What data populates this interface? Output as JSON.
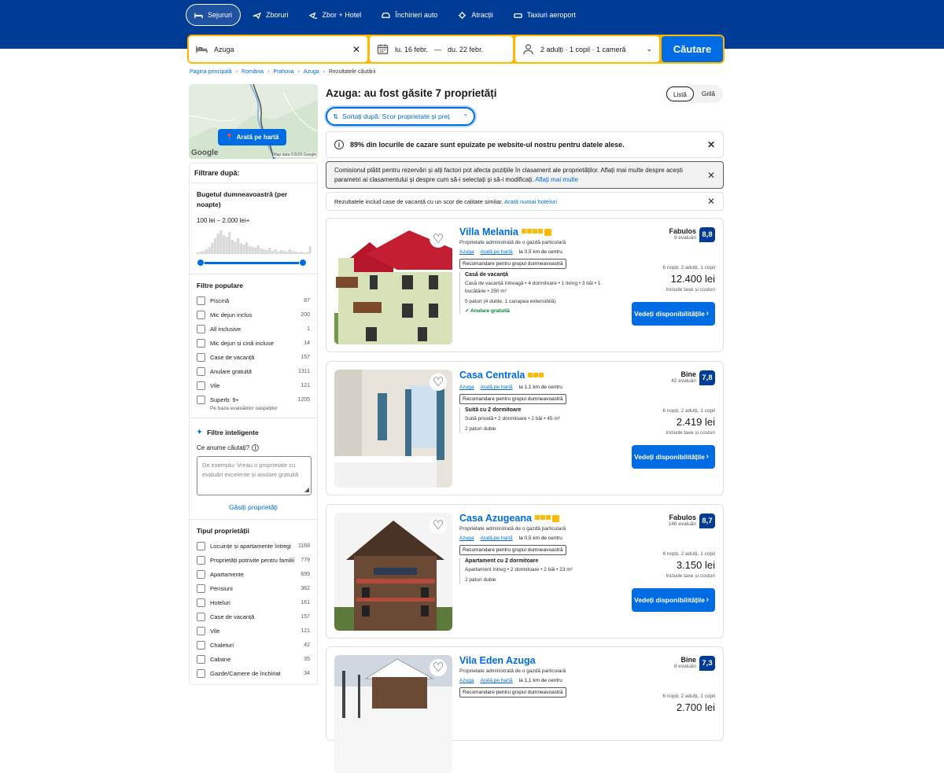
{
  "nav": {
    "tabs": [
      {
        "label": "Sejururi",
        "icon": "bed-icon",
        "active": true
      },
      {
        "label": "Zboruri",
        "icon": "plane-icon"
      },
      {
        "label": "Zbor + Hotel",
        "icon": "plane-bed-icon"
      },
      {
        "label": "Închirieri auto",
        "icon": "car-icon"
      },
      {
        "label": "Atracții",
        "icon": "attractions-icon"
      },
      {
        "label": "Taxiuri aeroport",
        "icon": "taxi-icon"
      }
    ]
  },
  "search": {
    "destination": "Azuga",
    "checkin": "lu. 16 febr.",
    "dash": "—",
    "checkout": "du. 22 febr.",
    "occupancy": "2 adulți · 1 copil · 1 cameră",
    "button": "Căutare",
    "accent": "#ffb700"
  },
  "breadcrumb": [
    "Pagina principală",
    "România",
    "Prahova",
    "Azuga",
    "Rezultatele căutării"
  ],
  "map": {
    "button": "Arată pe hartă",
    "logo": "Google",
    "attribution": "Map data ©2026 Google"
  },
  "filters": {
    "title": "Filtrare după:",
    "budget_title": "Bugetul dumneavoastră (per noapte)",
    "budget_range": "100 lei – 2.000 lei+",
    "popular_title": "Filtre populare",
    "popular": [
      {
        "label": "Piscină",
        "count": "87"
      },
      {
        "label": "Mic dejun inclus",
        "count": "200"
      },
      {
        "label": "All inclusive",
        "count": "1"
      },
      {
        "label": "Mic dejun și cină incluse",
        "count": "14"
      },
      {
        "label": "Case de vacanță",
        "count": "157"
      },
      {
        "label": "Anulare gratuită",
        "count": "1311"
      },
      {
        "label": "Vile",
        "count": "121"
      },
      {
        "label": "Superb: 9+",
        "count": "1205",
        "sub": "Pe baza evaluărilor oaspeților"
      }
    ],
    "smart_title": "Filtre inteligente",
    "smart_question": "Ce anume căutați?",
    "smart_placeholder": "De exemplu: Vreau o proprietate cu evaluări excelente și anulare gratuită",
    "smart_link": "Găsiți proprietăți",
    "type_title": "Tipul proprietății",
    "types": [
      {
        "label": "Locuințe și apartamente întregi",
        "count": "1168"
      },
      {
        "label": "Proprietăți potrivite pentru familii",
        "count": "779"
      },
      {
        "label": "Apartamente",
        "count": "699"
      },
      {
        "label": "Pensiuni",
        "count": "362"
      },
      {
        "label": "Hoteluri",
        "count": "161"
      },
      {
        "label": "Case de vacanță",
        "count": "157"
      },
      {
        "label": "Vile",
        "count": "121"
      },
      {
        "label": "Chaleturi",
        "count": "42"
      },
      {
        "label": "Cabane",
        "count": "35"
      },
      {
        "label": "Gazde/Camere de închiriat",
        "count": "34"
      }
    ]
  },
  "results": {
    "heading": "Azuga: au fost găsite 7 proprietăți",
    "view_list": "Listă",
    "view_grid": "Grilă",
    "sort": "Sortați după: Scor proprietate și preț",
    "alert1": "89% din locurile de cazare sunt epuizate pe website-ul nostru pentru datele alese.",
    "alert2": "Comisionul plătit pentru rezervări și alți factori pot afecta pozițiile în clasament ale proprietăților. Aflați mai multe despre acești parametri ai clasamentului și despre cum să-i selectați și să-i modificați.",
    "alert2_link": "Aflați mai multe",
    "alert3": "Rezultatele includ case de vacanță cu un scor de calitate similar.",
    "alert3_link": "Arată numai hoteluri"
  },
  "properties": [
    {
      "name": "Villa Melania",
      "stars": 4,
      "thumb": true,
      "sub": "Proprietate administrată de o gazdă particulară",
      "loc_town": "Azuga",
      "loc_map": "Arată pe hartă",
      "loc_dist": "la 0,5 km de centru",
      "rec": "Recomandare pentru grupul dumneavoastră",
      "room": "Casă de vacanță",
      "details1": "Casă de vacanță întreagă • 4 dormitoare • 1 living • 3 băi • 1 bucătărie • 250 m²",
      "details2": "5 paturi (4 duble, 1 canapea extensibilă)",
      "cancel": "Anulare gratuită",
      "score_word": "Fabulos",
      "reviews": "9 evaluări",
      "score": "8,8",
      "stay": "6 nopți, 2 adulți, 1 copil",
      "price": "12.400 lei",
      "taxes": "Include taxe și costuri",
      "cta": "Vedeți disponibilitățile"
    },
    {
      "name": "Casa Centrala",
      "stars": 3,
      "thumb": false,
      "loc_town": "Azuga",
      "loc_map": "Arată pe hartă",
      "loc_dist": "la 1,1 km de centru",
      "rec": "Recomandare pentru grupul dumneavoastră",
      "room": "Suită cu 2 dormitoare",
      "details1": "Suită privată • 2 dormitoare • 2 băi • 45 m²",
      "details2": "2 paturi duble",
      "score_word": "Bine",
      "reviews": "42 evaluări",
      "score": "7,8",
      "stay": "6 nopți, 2 adulți, 1 copil",
      "price": "2.419 lei",
      "taxes": "Include taxe și costuri",
      "cta": "Vedeți disponibilitățile"
    },
    {
      "name": "Casa Azugeana",
      "stars": 3,
      "thumb": true,
      "sub": "Proprietate administrată de o gazdă particulară",
      "loc_town": "Azuga",
      "loc_map": "Arată pe hartă",
      "loc_dist": "la 0,5 km de centru",
      "rec": "Recomandare pentru grupul dumneavoastră",
      "room": "Apartament cu 2 dormitoare",
      "details1": "Apartament întreg • 2 dormitoare • 2 băi • 23 m²",
      "details2": "2 paturi duble",
      "score_word": "Fabulos",
      "reviews": "146 evaluări",
      "score": "8,7",
      "stay": "6 nopți, 2 adulți, 1 copil",
      "price": "3.150 lei",
      "taxes": "Include taxe și costuri",
      "cta": "Vedeți disponibilitățile"
    },
    {
      "name": "Vila Eden Azuga",
      "stars": 0,
      "thumb": false,
      "sub": "Proprietate administrată de o gazdă particulară",
      "loc_town": "Azuga",
      "loc_map": "Arată pe hartă",
      "loc_dist": "la 1,1 km de centru",
      "rec": "Recomandare pentru grupul dumneavoastră",
      "score_word": "Bine",
      "reviews": "8 evaluări",
      "score": "7,3",
      "stay": "6 nopți, 2 adulți, 1 copil",
      "price": "2.700 lei"
    }
  ]
}
